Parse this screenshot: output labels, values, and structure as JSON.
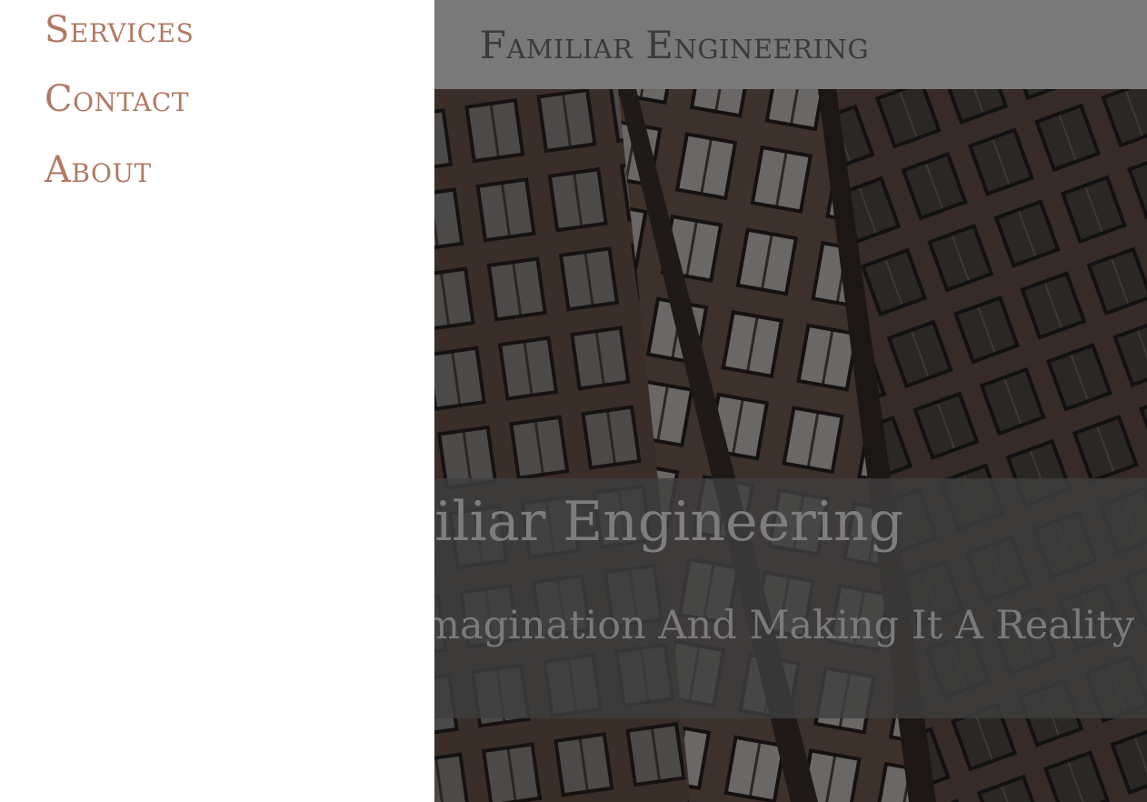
{
  "header": {
    "site_title": "Familiar Engineering"
  },
  "hero": {
    "heading": "Familiar Engineering",
    "tagline": "Taking Your Imagination And Making It A Reality"
  },
  "drawer": {
    "nav_items": [
      {
        "label": "Services"
      },
      {
        "label": "Contact"
      },
      {
        "label": "About"
      }
    ]
  },
  "colors": {
    "nav_link": "#b07a64",
    "header_bar": "#797979",
    "hero_band": "#3e3e3e",
    "building_bg": "#2e2622"
  }
}
